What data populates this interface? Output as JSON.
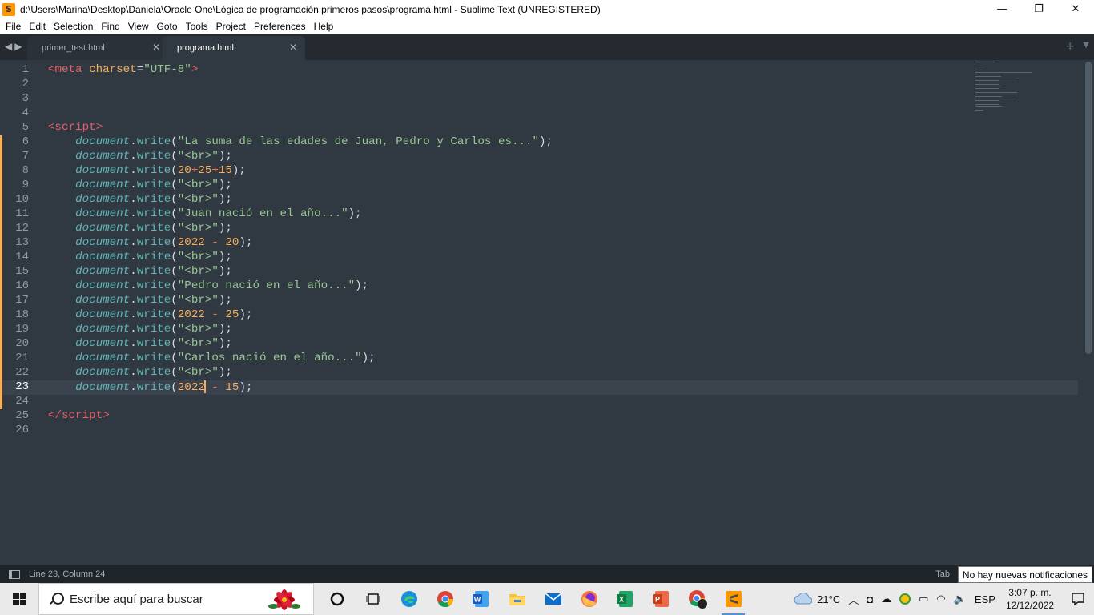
{
  "window": {
    "title": "d:\\Users\\Marina\\Desktop\\Daniela\\Oracle One\\Lógica de programación primeros pasos\\programa.html - Sublime Text (UNREGISTERED)",
    "app_icon_letter": "S",
    "minimize": "—",
    "maximize": "❐",
    "close": "✕"
  },
  "menu": [
    "File",
    "Edit",
    "Selection",
    "Find",
    "View",
    "Goto",
    "Tools",
    "Project",
    "Preferences",
    "Help"
  ],
  "tabs": [
    {
      "label": "primer_test.html",
      "active": false
    },
    {
      "label": "programa.html",
      "active": true
    }
  ],
  "tab_controls": {
    "nav": "◀▶",
    "close": "✕",
    "new": "+",
    "dropdown": "▼"
  },
  "editor": {
    "current_line": 23,
    "modified_lines": [
      6,
      7,
      8,
      9,
      10,
      11,
      12,
      13,
      14,
      15,
      16,
      17,
      18,
      19,
      20,
      21,
      22,
      23,
      24
    ],
    "lines": [
      [
        [
          "tag",
          "<meta "
        ],
        [
          "attr",
          "charset"
        ],
        [
          "punc",
          "="
        ],
        [
          "str",
          "\"UTF-8\""
        ],
        [
          "tag",
          ">"
        ]
      ],
      [],
      [],
      [],
      [
        [
          "tag",
          "<script"
        ],
        [
          "tag",
          ">"
        ]
      ],
      [
        [
          "punc",
          "    "
        ],
        [
          "obj",
          "document"
        ],
        [
          "punc",
          "."
        ],
        [
          "meth",
          "write"
        ],
        [
          "punc",
          "("
        ],
        [
          "str",
          "\"La suma de las edades de Juan, Pedro y Carlos es...\""
        ],
        [
          "punc",
          ");"
        ]
      ],
      [
        [
          "punc",
          "    "
        ],
        [
          "obj",
          "document"
        ],
        [
          "punc",
          "."
        ],
        [
          "meth",
          "write"
        ],
        [
          "punc",
          "("
        ],
        [
          "str",
          "\"<br>\""
        ],
        [
          "punc",
          ");"
        ]
      ],
      [
        [
          "punc",
          "    "
        ],
        [
          "obj",
          "document"
        ],
        [
          "punc",
          "."
        ],
        [
          "meth",
          "write"
        ],
        [
          "punc",
          "("
        ],
        [
          "num",
          "20"
        ],
        [
          "op",
          "+"
        ],
        [
          "num",
          "25"
        ],
        [
          "op",
          "+"
        ],
        [
          "num",
          "15"
        ],
        [
          "punc",
          ");"
        ]
      ],
      [
        [
          "punc",
          "    "
        ],
        [
          "obj",
          "document"
        ],
        [
          "punc",
          "."
        ],
        [
          "meth",
          "write"
        ],
        [
          "punc",
          "("
        ],
        [
          "str",
          "\"<br>\""
        ],
        [
          "punc",
          ");"
        ]
      ],
      [
        [
          "punc",
          "    "
        ],
        [
          "obj",
          "document"
        ],
        [
          "punc",
          "."
        ],
        [
          "meth",
          "write"
        ],
        [
          "punc",
          "("
        ],
        [
          "str",
          "\"<br>\""
        ],
        [
          "punc",
          ");"
        ]
      ],
      [
        [
          "punc",
          "    "
        ],
        [
          "obj",
          "document"
        ],
        [
          "punc",
          "."
        ],
        [
          "meth",
          "write"
        ],
        [
          "punc",
          "("
        ],
        [
          "str",
          "\"Juan nació en el año...\""
        ],
        [
          "punc",
          ");"
        ]
      ],
      [
        [
          "punc",
          "    "
        ],
        [
          "obj",
          "document"
        ],
        [
          "punc",
          "."
        ],
        [
          "meth",
          "write"
        ],
        [
          "punc",
          "("
        ],
        [
          "str",
          "\"<br>\""
        ],
        [
          "punc",
          ");"
        ]
      ],
      [
        [
          "punc",
          "    "
        ],
        [
          "obj",
          "document"
        ],
        [
          "punc",
          "."
        ],
        [
          "meth",
          "write"
        ],
        [
          "punc",
          "("
        ],
        [
          "num",
          "2022"
        ],
        [
          "punc",
          " "
        ],
        [
          "op",
          "-"
        ],
        [
          "punc",
          " "
        ],
        [
          "num",
          "20"
        ],
        [
          "punc",
          ");"
        ]
      ],
      [
        [
          "punc",
          "    "
        ],
        [
          "obj",
          "document"
        ],
        [
          "punc",
          "."
        ],
        [
          "meth",
          "write"
        ],
        [
          "punc",
          "("
        ],
        [
          "str",
          "\"<br>\""
        ],
        [
          "punc",
          ");"
        ]
      ],
      [
        [
          "punc",
          "    "
        ],
        [
          "obj",
          "document"
        ],
        [
          "punc",
          "."
        ],
        [
          "meth",
          "write"
        ],
        [
          "punc",
          "("
        ],
        [
          "str",
          "\"<br>\""
        ],
        [
          "punc",
          ");"
        ]
      ],
      [
        [
          "punc",
          "    "
        ],
        [
          "obj",
          "document"
        ],
        [
          "punc",
          "."
        ],
        [
          "meth",
          "write"
        ],
        [
          "punc",
          "("
        ],
        [
          "str",
          "\"Pedro nació en el año...\""
        ],
        [
          "punc",
          ");"
        ]
      ],
      [
        [
          "punc",
          "    "
        ],
        [
          "obj",
          "document"
        ],
        [
          "punc",
          "."
        ],
        [
          "meth",
          "write"
        ],
        [
          "punc",
          "("
        ],
        [
          "str",
          "\"<br>\""
        ],
        [
          "punc",
          ");"
        ]
      ],
      [
        [
          "punc",
          "    "
        ],
        [
          "obj",
          "document"
        ],
        [
          "punc",
          "."
        ],
        [
          "meth",
          "write"
        ],
        [
          "punc",
          "("
        ],
        [
          "num",
          "2022"
        ],
        [
          "punc",
          " "
        ],
        [
          "op",
          "-"
        ],
        [
          "punc",
          " "
        ],
        [
          "num",
          "25"
        ],
        [
          "punc",
          ");"
        ]
      ],
      [
        [
          "punc",
          "    "
        ],
        [
          "obj",
          "document"
        ],
        [
          "punc",
          "."
        ],
        [
          "meth",
          "write"
        ],
        [
          "punc",
          "("
        ],
        [
          "str",
          "\"<br>\""
        ],
        [
          "punc",
          ");"
        ]
      ],
      [
        [
          "punc",
          "    "
        ],
        [
          "obj",
          "document"
        ],
        [
          "punc",
          "."
        ],
        [
          "meth",
          "write"
        ],
        [
          "punc",
          "("
        ],
        [
          "str",
          "\"<br>\""
        ],
        [
          "punc",
          ");"
        ]
      ],
      [
        [
          "punc",
          "    "
        ],
        [
          "obj",
          "document"
        ],
        [
          "punc",
          "."
        ],
        [
          "meth",
          "write"
        ],
        [
          "punc",
          "("
        ],
        [
          "str",
          "\"Carlos nació en el año...\""
        ],
        [
          "punc",
          ");"
        ]
      ],
      [
        [
          "punc",
          "    "
        ],
        [
          "obj",
          "document"
        ],
        [
          "punc",
          "."
        ],
        [
          "meth",
          "write"
        ],
        [
          "punc",
          "("
        ],
        [
          "str",
          "\"<br>\""
        ],
        [
          "punc",
          ");"
        ]
      ],
      [
        [
          "punc",
          "    "
        ],
        [
          "obj",
          "document"
        ],
        [
          "punc",
          "."
        ],
        [
          "meth",
          "write"
        ],
        [
          "punc",
          "("
        ],
        [
          "num",
          "2022"
        ],
        [
          "caret",
          ""
        ],
        [
          "punc",
          " "
        ],
        [
          "op",
          "-"
        ],
        [
          "punc",
          " "
        ],
        [
          "num",
          "15"
        ],
        [
          "punc",
          ");"
        ]
      ],
      [],
      [
        [
          "tag",
          "</script"
        ],
        [
          "tag",
          ">"
        ]
      ],
      []
    ]
  },
  "status": {
    "position": "Line 23, Column 24",
    "tab_size_partial": "Tab",
    "tooltip": "No hay nuevas notificaciones"
  },
  "taskbar": {
    "search_placeholder": "Escribe aquí para buscar",
    "apps": [
      "cortana-icon",
      "task-view-icon",
      "edge-icon",
      "chrome-icon",
      "word-icon",
      "file-explorer-icon",
      "mail-icon",
      "firefox-icon",
      "excel-icon",
      "powerpoint-icon",
      "chrome-profile-icon",
      "sublime-text-icon"
    ],
    "active_app": "sublime-text-icon",
    "weather": "21°C",
    "language": "ESP",
    "time": "3:07 p. m.",
    "date": "12/12/2022"
  },
  "colors": {
    "editor_bg": "#303841",
    "tag": "#ec5f66",
    "string": "#99c794",
    "number": "#f9ae58",
    "method": "#5fb4b4",
    "modified_marker": "#f9ae58"
  }
}
